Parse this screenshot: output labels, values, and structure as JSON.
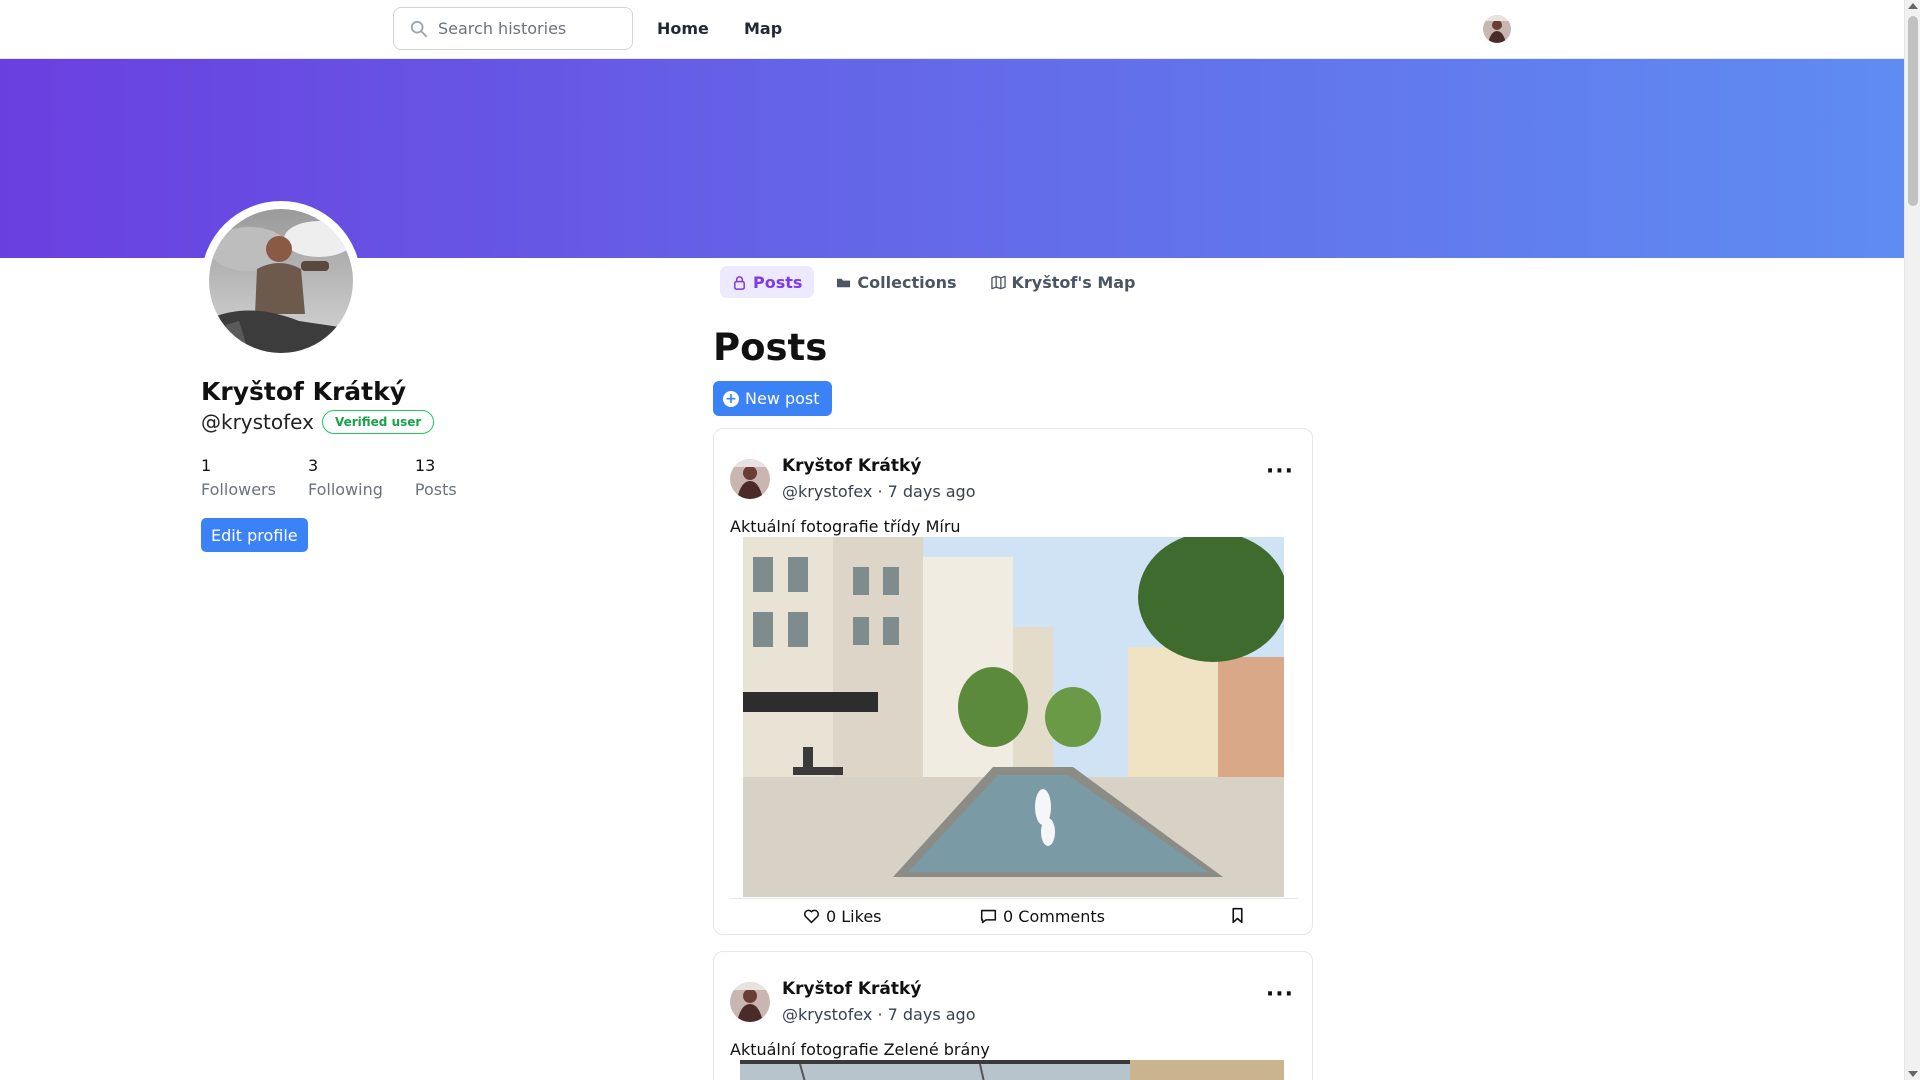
{
  "nav": {
    "search_placeholder": "Search histories",
    "home": "Home",
    "map": "Map"
  },
  "profile": {
    "name": "Kryštof Krátký",
    "handle": "@krystofex",
    "badge": "Verified user",
    "stats": [
      {
        "value": "1",
        "label": "Followers"
      },
      {
        "value": "3",
        "label": "Following"
      },
      {
        "value": "13",
        "label": "Posts"
      }
    ],
    "edit_label": "Edit profile"
  },
  "tabs": [
    {
      "label": "Posts",
      "icon": "lock-icon",
      "active": true
    },
    {
      "label": "Collections",
      "icon": "folder-icon",
      "active": false
    },
    {
      "label": "Kryštof's Map",
      "icon": "map-icon",
      "active": false
    }
  ],
  "main": {
    "title": "Posts",
    "new_post": "New post"
  },
  "posts": [
    {
      "author": "Kryštof Krátký",
      "meta": "@krystofex · 7 days ago",
      "text": "Aktuální fotografie třídy Míru",
      "likes": "0 Likes",
      "comments": "0 Comments"
    },
    {
      "author": "Kryštof Krátký",
      "meta": "@krystofex · 7 days ago",
      "text": "Aktuální fotografie Zelené brány"
    }
  ],
  "colors": {
    "accent": "#3b82f6",
    "tab_active_bg": "#ede9fe",
    "tab_active_text": "#7c3aed",
    "banner_start": "#6a3fe0",
    "banner_end": "#5f8cf2",
    "verified": "#16a34a"
  }
}
